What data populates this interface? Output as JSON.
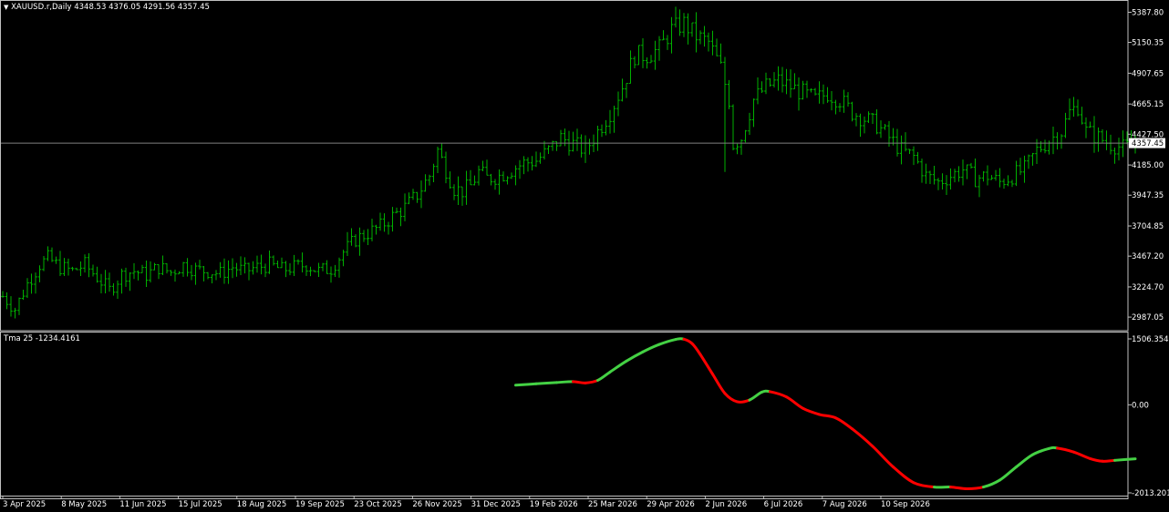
{
  "header": {
    "symbol_line": "XAUUSD.r,Daily  4348.53 4376.05 4291.56 4357.45",
    "dropdown_icon": "triangle-down-icon"
  },
  "indicator": {
    "label": "Tma 25 -1234.4161"
  },
  "colors": {
    "background": "#000000",
    "candle": "#00b000",
    "grid_frame": "#c0c0c0",
    "price_line": "#808080",
    "tma_up": "#44d144",
    "tma_down": "#ff0000"
  },
  "chart_data": [
    {
      "type": "ohlc",
      "title": "XAUUSD.r,Daily",
      "last_price": "4357.45",
      "ylim": [
        2880,
        5470
      ],
      "y_ticks": [
        "5387.80",
        "5150.35",
        "4907.65",
        "4665.15",
        "4427.50",
        "4185.00",
        "3947.35",
        "3704.85",
        "3467.20",
        "3224.70",
        "2987.05"
      ],
      "x_ticks": [
        "3 Apr 2025",
        "8 May 2025",
        "11 Jun 2025",
        "15 Jul 2025",
        "18 Aug 2025",
        "19 Sep 2025",
        "23 Oct 2025",
        "26 Nov 2025",
        "31 Dec 2025",
        "19 Feb 2026",
        "25 Mar 2026",
        "29 Apr 2026",
        "2 Jun 2026",
        "6 Jul 2026",
        "7 Aug 2026",
        "10 Sep 2026"
      ],
      "close_path": [
        [
          0,
          3150
        ],
        [
          3,
          3050
        ],
        [
          6,
          3250
        ],
        [
          9,
          3400
        ],
        [
          11,
          3450
        ],
        [
          14,
          3380
        ],
        [
          17,
          3350
        ],
        [
          20,
          3400
        ],
        [
          23,
          3300
        ],
        [
          26,
          3200
        ],
        [
          29,
          3320
        ],
        [
          32,
          3350
        ],
        [
          35,
          3320
        ],
        [
          38,
          3380
        ],
        [
          41,
          3340
        ],
        [
          44,
          3400
        ],
        [
          47,
          3360
        ],
        [
          50,
          3350
        ],
        [
          53,
          3330
        ],
        [
          56,
          3380
        ],
        [
          59,
          3350
        ],
        [
          62,
          3380
        ],
        [
          65,
          3400
        ],
        [
          68,
          3360
        ],
        [
          71,
          3380
        ],
        [
          74,
          3400
        ],
        [
          77,
          3350
        ],
        [
          80,
          3370
        ],
        [
          83,
          3500
        ],
        [
          86,
          3600
        ],
        [
          89,
          3650
        ],
        [
          92,
          3700
        ],
        [
          95,
          3780
        ],
        [
          98,
          3850
        ],
        [
          101,
          3950
        ],
        [
          104,
          4100
        ],
        [
          106,
          4300
        ],
        [
          108,
          4150
        ],
        [
          110,
          4000
        ],
        [
          112,
          3980
        ],
        [
          114,
          4020
        ],
        [
          116,
          4130
        ],
        [
          118,
          4080
        ],
        [
          121,
          4100
        ],
        [
          124,
          4150
        ],
        [
          127,
          4200
        ],
        [
          130,
          4220
        ],
        [
          133,
          4300
        ],
        [
          136,
          4400
        ],
        [
          139,
          4350
        ],
        [
          142,
          4300
        ],
        [
          145,
          4450
        ],
        [
          148,
          4600
        ],
        [
          151,
          4800
        ],
        [
          154,
          5050
        ],
        [
          157,
          5050
        ],
        [
          160,
          5100
        ],
        [
          163,
          5250
        ],
        [
          166,
          5300
        ],
        [
          169,
          5200
        ],
        [
          172,
          5150
        ],
        [
          175,
          4950
        ],
        [
          177,
          4700
        ],
        [
          178,
          4350
        ],
        [
          180,
          4400
        ],
        [
          183,
          4700
        ],
        [
          186,
          4800
        ],
        [
          189,
          4850
        ],
        [
          192,
          4800
        ],
        [
          195,
          4750
        ],
        [
          198,
          4700
        ],
        [
          201,
          4750
        ],
        [
          204,
          4700
        ],
        [
          207,
          4600
        ],
        [
          210,
          4550
        ],
        [
          213,
          4500
        ],
        [
          216,
          4400
        ],
        [
          219,
          4300
        ],
        [
          222,
          4250
        ],
        [
          225,
          4100
        ],
        [
          228,
          4050
        ],
        [
          231,
          4100
        ],
        [
          234,
          4150
        ],
        [
          237,
          4080
        ],
        [
          240,
          4100
        ],
        [
          243,
          4050
        ],
        [
          246,
          4100
        ],
        [
          249,
          4150
        ],
        [
          252,
          4300
        ],
        [
          255,
          4380
        ],
        [
          258,
          4450
        ],
        [
          260,
          4600
        ],
        [
          262,
          4650
        ],
        [
          264,
          4450
        ],
        [
          267,
          4400
        ],
        [
          270,
          4350
        ],
        [
          273,
          4320
        ],
        [
          276,
          4340
        ]
      ]
    },
    {
      "type": "line",
      "title": "Tma 25",
      "value": "-1234.4161",
      "ylim": [
        -2013.2014,
        1506.3549
      ],
      "y_ticks": [
        "1506.3549",
        "0.00",
        "-2013.2014"
      ],
      "x_start": 125,
      "x_end": 276,
      "series": [
        {
          "x": 125,
          "y": 450,
          "trend": "up"
        },
        {
          "x": 130,
          "y": 480,
          "trend": "up"
        },
        {
          "x": 135,
          "y": 510,
          "trend": "up"
        },
        {
          "x": 139,
          "y": 530,
          "trend": "down"
        },
        {
          "x": 142,
          "y": 500,
          "trend": "down"
        },
        {
          "x": 145,
          "y": 560,
          "trend": "up"
        },
        {
          "x": 148,
          "y": 750,
          "trend": "up"
        },
        {
          "x": 152,
          "y": 1000,
          "trend": "up"
        },
        {
          "x": 156,
          "y": 1210,
          "trend": "up"
        },
        {
          "x": 160,
          "y": 1380,
          "trend": "up"
        },
        {
          "x": 164,
          "y": 1495,
          "trend": "up"
        },
        {
          "x": 166,
          "y": 1500,
          "trend": "down"
        },
        {
          "x": 168,
          "y": 1400,
          "trend": "down"
        },
        {
          "x": 170,
          "y": 1150,
          "trend": "down"
        },
        {
          "x": 173,
          "y": 700,
          "trend": "down"
        },
        {
          "x": 176,
          "y": 260,
          "trend": "down"
        },
        {
          "x": 179,
          "y": 70,
          "trend": "down"
        },
        {
          "x": 182,
          "y": 110,
          "trend": "up"
        },
        {
          "x": 185,
          "y": 290,
          "trend": "up"
        },
        {
          "x": 187,
          "y": 300,
          "trend": "down"
        },
        {
          "x": 191,
          "y": 180,
          "trend": "down"
        },
        {
          "x": 195,
          "y": -80,
          "trend": "down"
        },
        {
          "x": 199,
          "y": -220,
          "trend": "down"
        },
        {
          "x": 203,
          "y": -300,
          "trend": "down"
        },
        {
          "x": 207,
          "y": -550,
          "trend": "down"
        },
        {
          "x": 212,
          "y": -950,
          "trend": "down"
        },
        {
          "x": 217,
          "y": -1420,
          "trend": "down"
        },
        {
          "x": 222,
          "y": -1780,
          "trend": "down"
        },
        {
          "x": 227,
          "y": -1880,
          "trend": "up"
        },
        {
          "x": 231,
          "y": -1880,
          "trend": "down"
        },
        {
          "x": 235,
          "y": -1920,
          "trend": "down"
        },
        {
          "x": 239,
          "y": -1880,
          "trend": "up"
        },
        {
          "x": 243,
          "y": -1720,
          "trend": "up"
        },
        {
          "x": 247,
          "y": -1420,
          "trend": "up"
        },
        {
          "x": 251,
          "y": -1140,
          "trend": "up"
        },
        {
          "x": 255,
          "y": -1000,
          "trend": "up"
        },
        {
          "x": 257,
          "y": -990,
          "trend": "down"
        },
        {
          "x": 261,
          "y": -1080,
          "trend": "down"
        },
        {
          "x": 265,
          "y": -1230,
          "trend": "down"
        },
        {
          "x": 268,
          "y": -1290,
          "trend": "down"
        },
        {
          "x": 271,
          "y": -1270,
          "trend": "up"
        },
        {
          "x": 276,
          "y": -1234,
          "trend": "up"
        }
      ]
    }
  ]
}
